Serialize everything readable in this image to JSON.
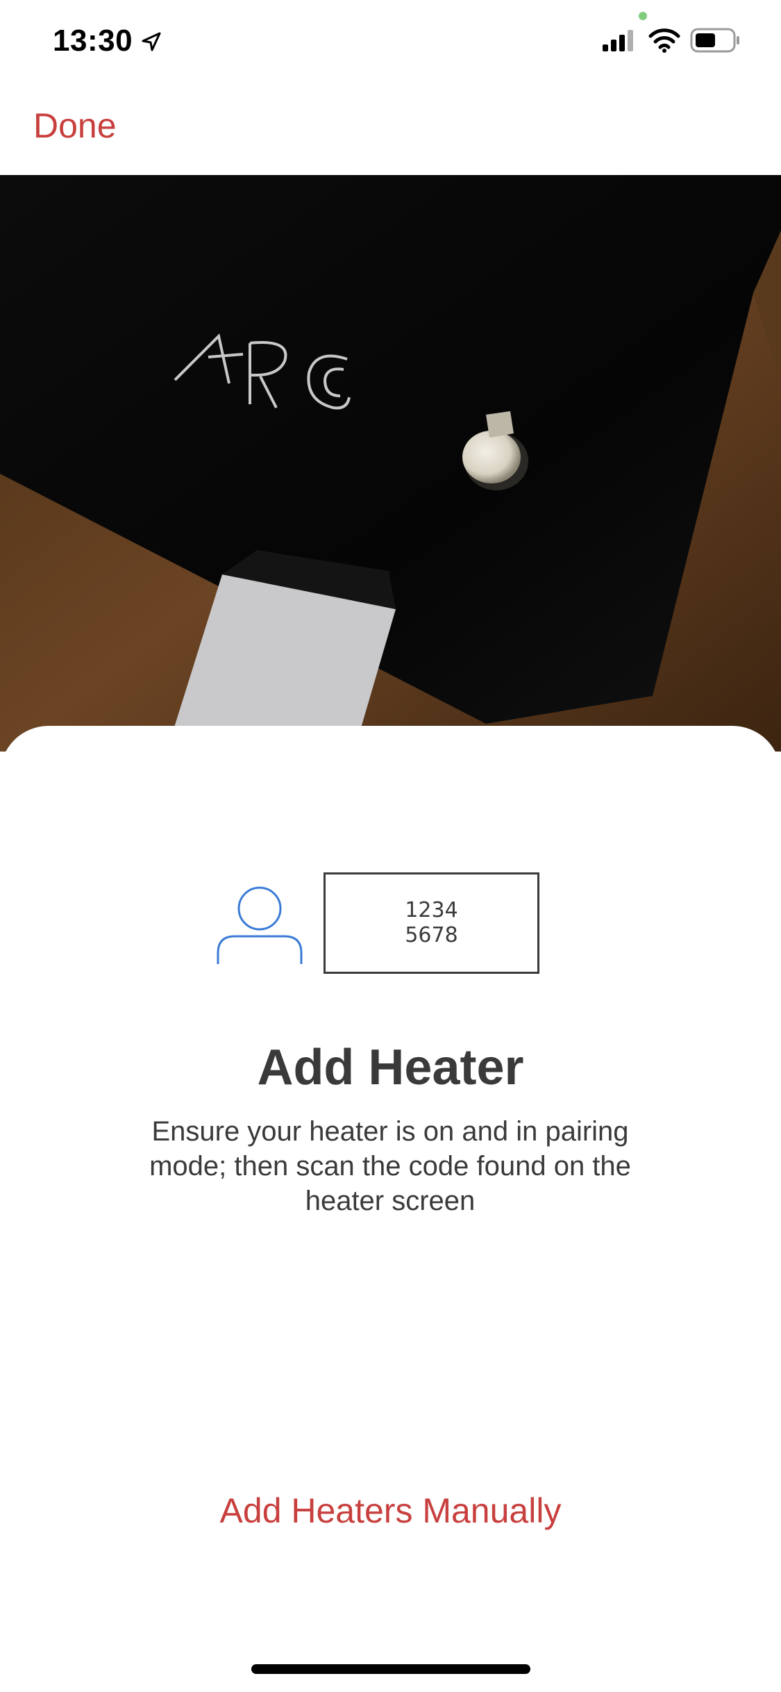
{
  "status_bar": {
    "time": "13:30",
    "icons": [
      "location-arrow-icon",
      "signal-icon",
      "wifi-icon",
      "battery-icon"
    ]
  },
  "nav": {
    "done_label": "Done"
  },
  "camera": {
    "brand_mark": "ARC"
  },
  "sheet": {
    "code_line_1": "1234",
    "code_line_2": "5678",
    "title": "Add Heater",
    "description": "Ensure your heater is on and in pairing mode; then scan the code found on the heater screen",
    "manual_label": "Add Heaters Manually"
  },
  "colors": {
    "accent": "#c8403e",
    "icon_blue": "#3a7bd5",
    "text": "#3a3a3a"
  }
}
